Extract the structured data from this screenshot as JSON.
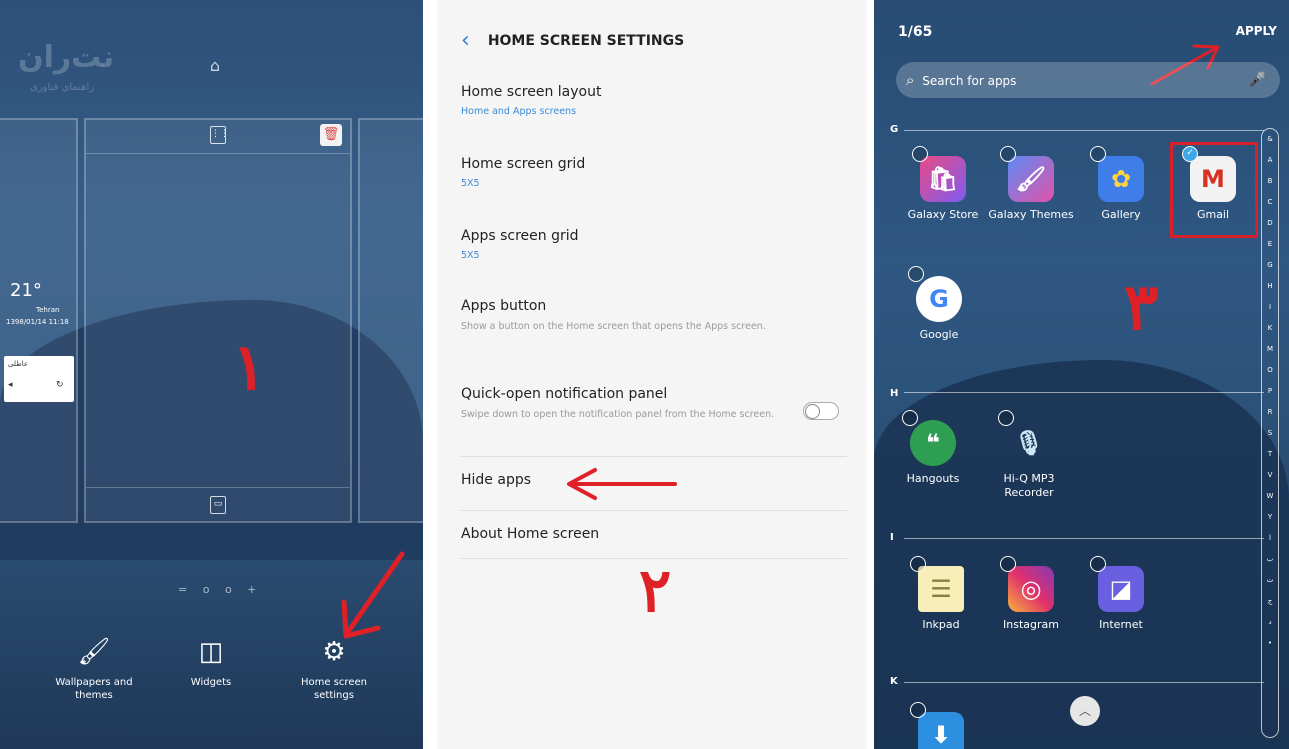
{
  "panel1": {
    "logo_text": "نت‌ران",
    "logo_sub": "راهنمای فناوری",
    "weather": {
      "temp": "21°",
      "city": "Tehran",
      "date": "1398/01/14 11:18"
    },
    "widget_text": "عاطلی",
    "page_dots": "= o o +",
    "marker": "۱",
    "bottom_items": [
      {
        "label": "Wallpapers and themes",
        "icon": "brush-icon"
      },
      {
        "label": "Widgets",
        "icon": "widgets-icon"
      },
      {
        "label": "Home screen settings",
        "icon": "gear-icon"
      }
    ]
  },
  "panel2": {
    "title": "HOME SCREEN SETTINGS",
    "items": [
      {
        "title": "Home screen layout",
        "sub": "Home and Apps screens"
      },
      {
        "title": "Home screen grid",
        "sub": "5X5"
      },
      {
        "title": "Apps screen grid",
        "sub": "5X5"
      },
      {
        "title": "Apps button",
        "desc": "Show a button on the Home screen that opens the Apps screen."
      },
      {
        "title": "Quick-open notification panel",
        "desc": "Swipe down to open the notification panel from the Home screen."
      },
      {
        "title": "Hide apps"
      },
      {
        "title": "About Home screen"
      }
    ],
    "toggle_on": false,
    "marker": "۲"
  },
  "panel3": {
    "counter": "1/65",
    "apply": "APPLY",
    "search_placeholder": "Search for apps",
    "sections": [
      "G",
      "H",
      "I",
      "K"
    ],
    "apps_g": [
      "Galaxy Store",
      "Galaxy Themes",
      "Gallery",
      "Gmail",
      "Google"
    ],
    "apps_h": [
      "Hangouts",
      "Hi-Q MP3 Recorder"
    ],
    "apps_i": [
      "Inkpad",
      "Instagram",
      "Internet"
    ],
    "alphabet": [
      "&",
      "A",
      "B",
      "C",
      "D",
      "E",
      "G",
      "H",
      "I",
      "K",
      "M",
      "O",
      "P",
      "R",
      "S",
      "T",
      "V",
      "W",
      "Y",
      "ا",
      "ب",
      "ت",
      "ج",
      "د",
      "•"
    ],
    "marker": "۳",
    "colors": {
      "highlight": "#d8202a"
    }
  }
}
